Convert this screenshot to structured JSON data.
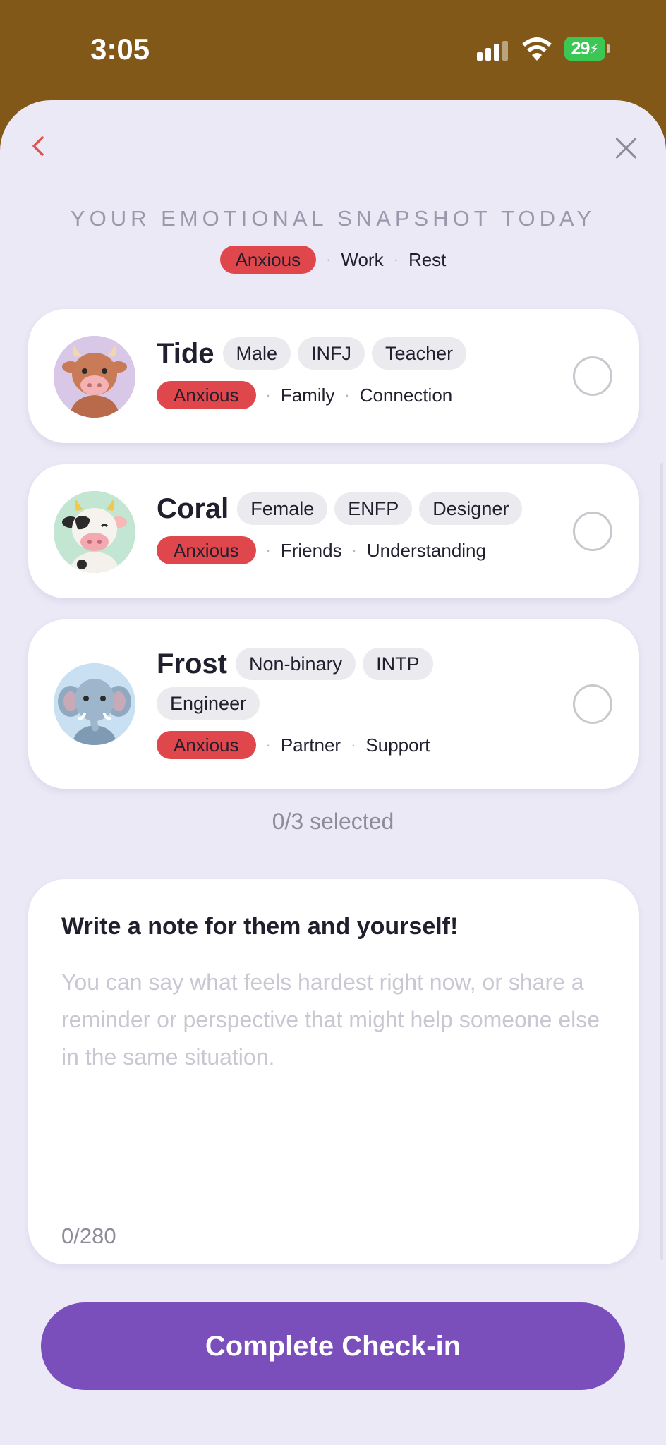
{
  "status": {
    "time": "3:05",
    "battery": "29"
  },
  "header": {
    "title": "YOUR EMOTIONAL SNAPSHOT TODAY",
    "mood": "Anxious",
    "tags": [
      "Work",
      "Rest"
    ]
  },
  "people": [
    {
      "name": "Tide",
      "chips": [
        "Male",
        "INFJ",
        "Teacher"
      ],
      "mood": "Anxious",
      "tags": [
        "Family",
        "Connection"
      ],
      "avatar": "cow-icon"
    },
    {
      "name": "Coral",
      "chips": [
        "Female",
        "ENFP",
        "Designer"
      ],
      "mood": "Anxious",
      "tags": [
        "Friends",
        "Understanding"
      ],
      "avatar": "dairy-cow-icon"
    },
    {
      "name": "Frost",
      "chips": [
        "Non-binary",
        "INTP",
        "Engineer"
      ],
      "mood": "Anxious",
      "tags": [
        "Partner",
        "Support"
      ],
      "avatar": "elephant-icon"
    }
  ],
  "selection": {
    "text": "0/3 selected"
  },
  "note": {
    "title": "Write a note for them and yourself!",
    "placeholder": "You can say what feels hardest right now, or share a reminder or perspective that might help someone else in the same situation.",
    "count": "0/280"
  },
  "actions": {
    "complete_label": "Complete Check-in"
  },
  "colors": {
    "accent": "#7a4fbc",
    "mood_red": "#e0474c",
    "background": "#ebe9f6",
    "status_bar": "#815817"
  }
}
